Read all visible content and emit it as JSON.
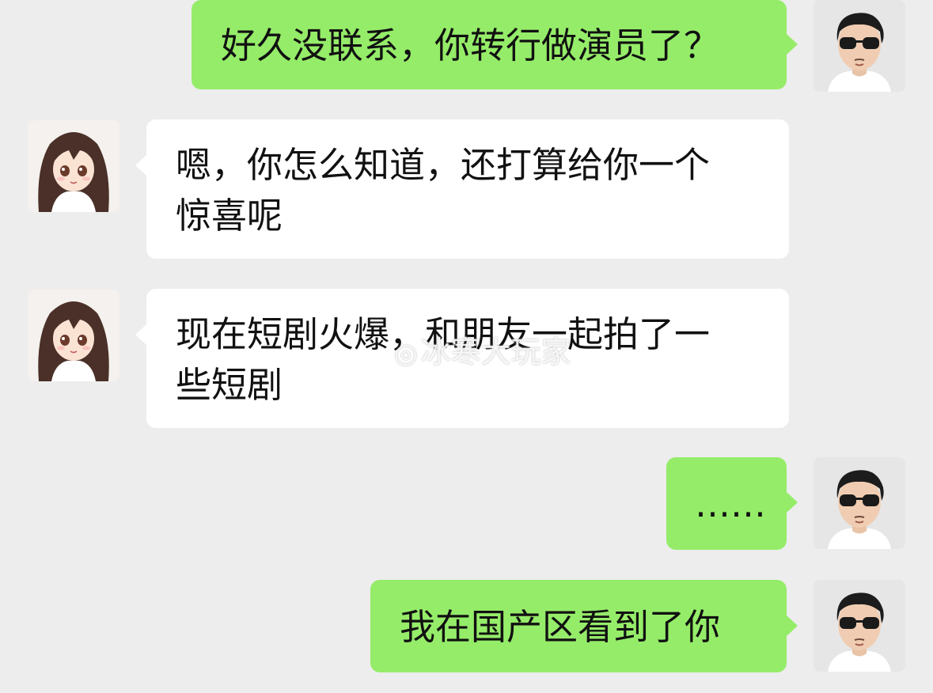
{
  "messages": [
    {
      "side": "right",
      "sender": "male",
      "text": "好久没联系，你转行做演员了？"
    },
    {
      "side": "left",
      "sender": "female",
      "lines": [
        "嗯，你怎么知道，还打算给你一个",
        "惊喜呢"
      ]
    },
    {
      "side": "left",
      "sender": "female",
      "lines": [
        "现在短剧火爆，和朋友一起拍了一",
        "些短剧"
      ]
    },
    {
      "side": "right",
      "sender": "male",
      "text": "……"
    },
    {
      "side": "right",
      "sender": "male",
      "text": "我在国产区看到了你"
    }
  ],
  "avatars": {
    "male": "man-with-sunglasses-avatar",
    "female": "anime-girl-avatar"
  },
  "colors": {
    "background": "#ededed",
    "sent_bubble": "#95ec69",
    "received_bubble": "#ffffff"
  },
  "watermark": {
    "icon": "weibo-icon",
    "text": "冰寒大玩家"
  }
}
